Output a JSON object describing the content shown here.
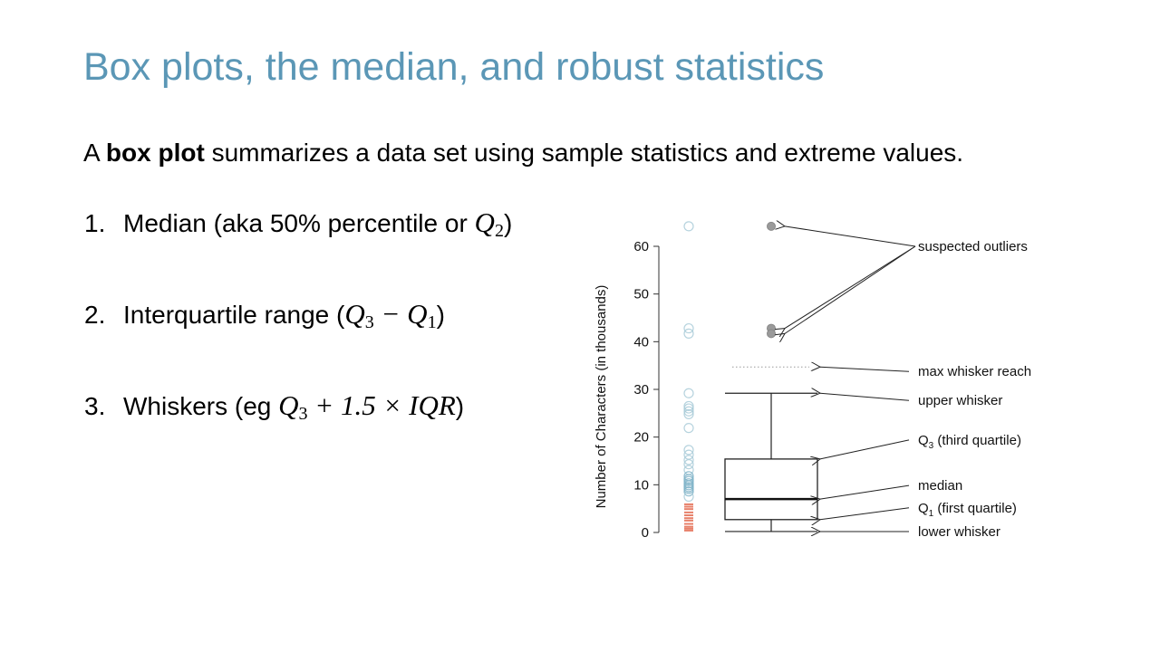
{
  "slide": {
    "title": "Box plots, the median, and robust statistics",
    "intro": {
      "prefix": "A ",
      "bold": "box plot",
      "suffix": " summarizes a data set using sample statistics and extreme values."
    },
    "items": [
      {
        "number": "1.",
        "text": "Median (aka 50% percentile or ",
        "math": "Q",
        "math_sub": "2",
        "math_rest": "",
        "close": ")"
      },
      {
        "number": "2.",
        "text": "Interquartile range (",
        "math": "Q",
        "math_sub": "3",
        "math_rest": " − Q",
        "math_sub2": "1",
        "close": ")"
      },
      {
        "number": "3.",
        "text": "Whiskers (eg ",
        "math": "Q",
        "math_sub": "3",
        "math_rest": " + 1.5 × IQR",
        "close": ")"
      }
    ]
  },
  "chart_data": {
    "type": "box",
    "title": "",
    "xlabel": "",
    "ylabel": "Number of Characters (in thousands)",
    "ylim": [
      0,
      60
    ],
    "yticks": [
      0,
      10,
      20,
      30,
      40,
      50,
      60
    ],
    "grid": false,
    "summary": {
      "lower_whisker": 0.2,
      "q1": 2.7,
      "median": 7.0,
      "q3": 15.4,
      "upper_whisker": 29.2,
      "max_whisker_reach": 34.7,
      "outliers": [
        64.2,
        42.8,
        41.7
      ]
    },
    "strip_points": {
      "circles": [
        64.2,
        42.8,
        41.7,
        29.2,
        26.5,
        26.0,
        25.4,
        24.8,
        21.9,
        17.3,
        16.3,
        15.2,
        14.3,
        13.1,
        11.8,
        11.2,
        10.8,
        10.3,
        9.9,
        9.5,
        9.1,
        8.6,
        7.5
      ],
      "dashes": [
        5.9,
        5.4,
        4.9,
        4.2,
        3.6,
        3.0,
        2.5,
        1.8,
        1.2,
        0.8,
        0.4
      ]
    },
    "annotations": [
      {
        "label": "suspected outliers",
        "targets": "outliers"
      },
      {
        "label": "max whisker reach",
        "targets": "max_whisker_reach"
      },
      {
        "label": "upper whisker",
        "targets": "upper_whisker"
      },
      {
        "label": "Q",
        "sub": "3",
        "rest": "  (third quartile)",
        "targets": "q3"
      },
      {
        "label": "median",
        "targets": "median"
      },
      {
        "label": "Q",
        "sub": "1",
        "rest": "  (first quartile)",
        "targets": "q1"
      },
      {
        "label": "lower whisker",
        "targets": "lower_whisker"
      }
    ],
    "colors": {
      "circle": "#a9cbd8",
      "circle_dark": "#7fb3c8",
      "dash": "#e36a50",
      "outlier_fill": "#9a9a9a",
      "box": "#222222",
      "dotted": "#999999"
    }
  }
}
